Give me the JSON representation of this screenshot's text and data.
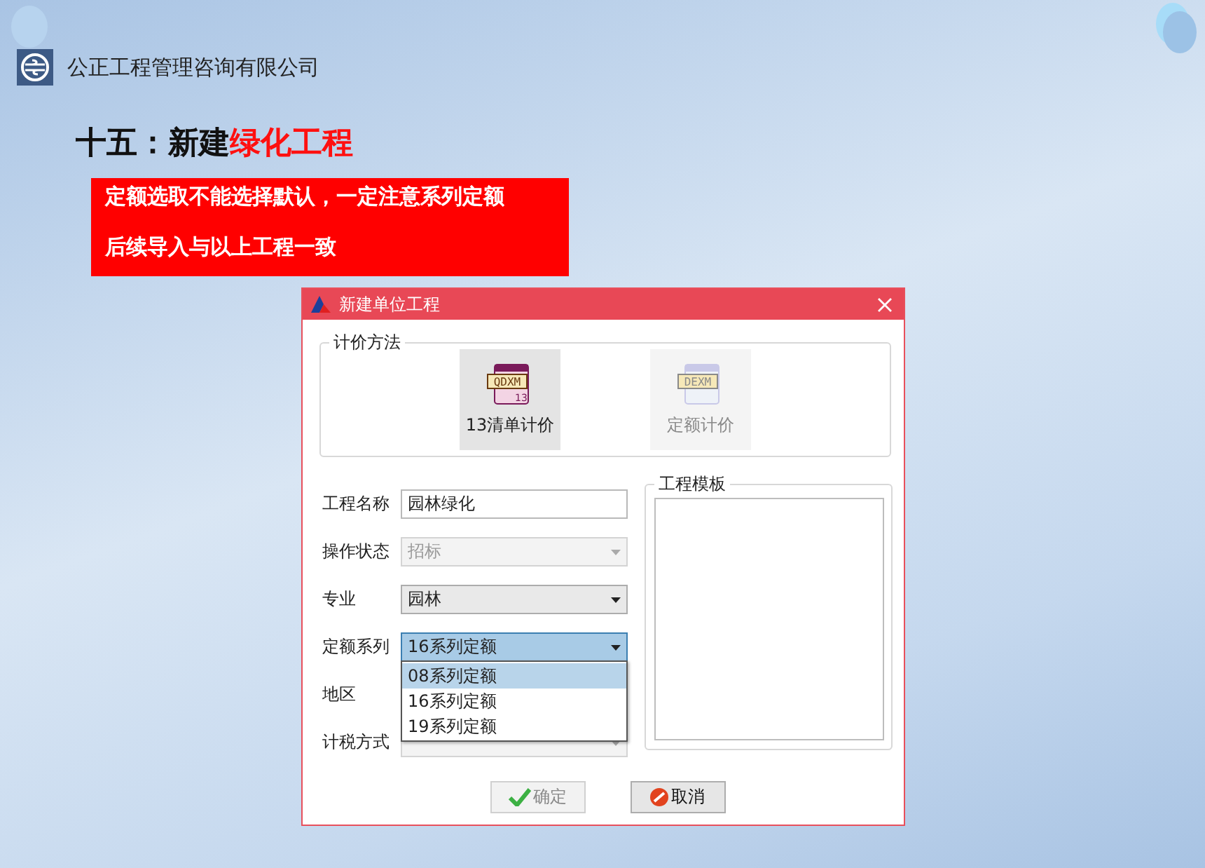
{
  "slide": {
    "company": "公正工程管理咨询有限公司",
    "title_prefix": "十五：新建",
    "title_highlight": "绿化工程",
    "notes": [
      "定额选取不能选择默认，一定注意系列定额",
      "后续导入与以上工程一致"
    ]
  },
  "dialog": {
    "title": "新建单位工程",
    "method_group": "计价方法",
    "methods": [
      {
        "label": "13清单计价",
        "badge": "QDXM",
        "number": "13",
        "selected": true,
        "disabled": false
      },
      {
        "label": "定额计价",
        "badge": "DEXM",
        "selected": false,
        "disabled": true
      }
    ],
    "fields": [
      {
        "label": "工程名称",
        "kind": "text",
        "value": "园林绿化",
        "disabled": false,
        "focused": false
      },
      {
        "label": "操作状态",
        "kind": "select",
        "value": "招标",
        "disabled": true,
        "focused": false
      },
      {
        "label": "专业",
        "kind": "select",
        "value": "园林",
        "disabled": false,
        "focused": false
      },
      {
        "label": "定额系列",
        "kind": "select",
        "value": "16系列定额",
        "disabled": false,
        "focused": true
      },
      {
        "label": "地区",
        "kind": "covered"
      },
      {
        "label": "计税方式",
        "kind": "select",
        "disabled": true,
        "focused": false
      }
    ],
    "dropdown": {
      "options": [
        {
          "label": "08系列定额",
          "selected": true
        },
        {
          "label": "16系列定额",
          "selected": false
        },
        {
          "label": "19系列定额",
          "selected": false
        }
      ]
    },
    "template_group": "工程模板",
    "buttons": [
      {
        "label": "确定",
        "kind": "ok",
        "disabled": true
      },
      {
        "label": "取消",
        "kind": "cancel",
        "disabled": false
      }
    ]
  }
}
